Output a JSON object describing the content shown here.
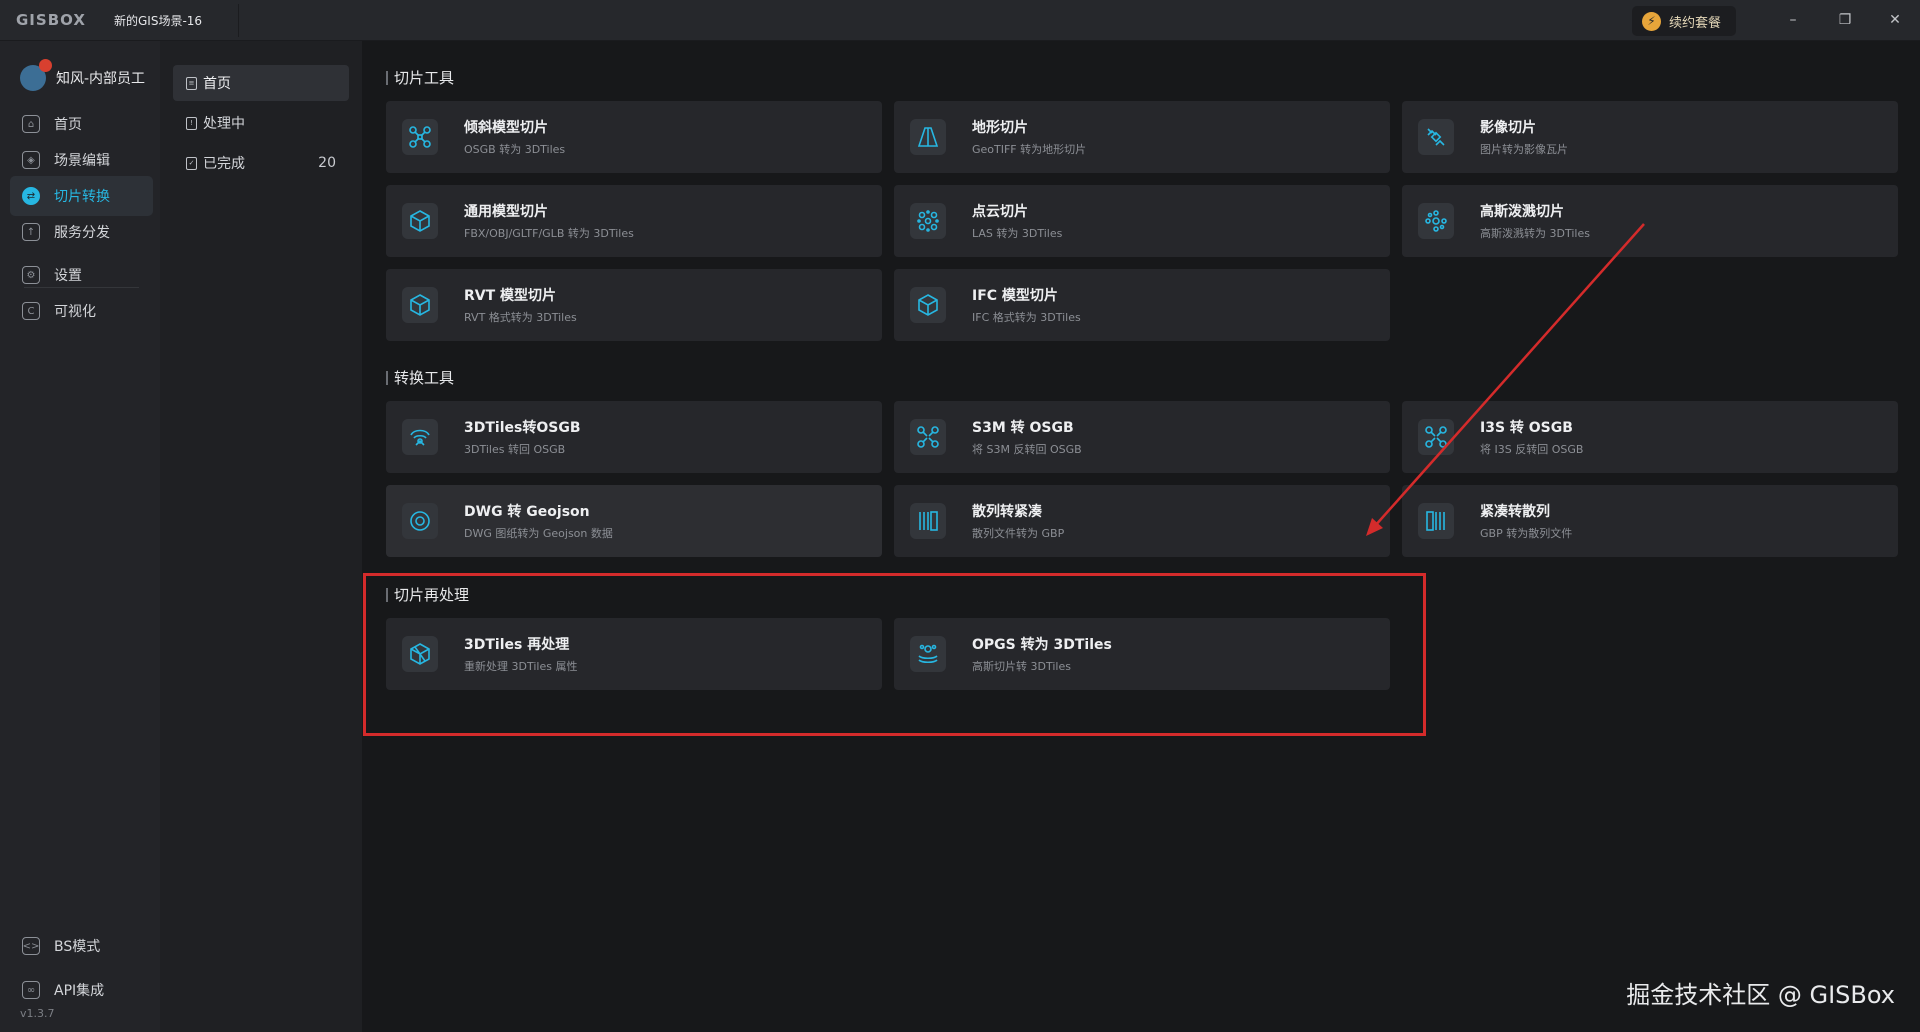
{
  "titlebar": {
    "logo": "GISBOX",
    "tab": "新的GIS场景-16",
    "renew_label": "续约套餐",
    "minimize": "–",
    "maximize": "❐",
    "close": "✕"
  },
  "user": {
    "name": "知风-内部员工"
  },
  "nav": [
    {
      "label": "首页",
      "icon": "home-icon",
      "active": false
    },
    {
      "label": "场景编辑",
      "icon": "cube-icon",
      "active": false
    },
    {
      "label": "切片转换",
      "icon": "swap-icon",
      "active": true
    },
    {
      "label": "服务分发",
      "icon": "upload-icon",
      "active": false
    },
    {
      "label": "设置",
      "icon": "gear-icon",
      "active": false
    },
    {
      "label": "可视化",
      "icon": "visual-icon",
      "active": false
    }
  ],
  "nav_bottom": [
    {
      "label": "BS模式",
      "icon": "code-icon"
    },
    {
      "label": "API集成",
      "icon": "link-icon"
    }
  ],
  "version": "v1.3.7",
  "subnav": [
    {
      "label": "首页",
      "count": ""
    },
    {
      "label": "处理中",
      "count": ""
    },
    {
      "label": "已完成",
      "count": "20"
    }
  ],
  "sections": [
    {
      "title": "切片工具",
      "cards": [
        {
          "title": "倾斜模型切片",
          "sub": "OSGB 转为 3DTiles",
          "icon": "drone-icon"
        },
        {
          "title": "地形切片",
          "sub": "GeoTIFF 转为地形切片",
          "icon": "terrain-icon"
        },
        {
          "title": "影像切片",
          "sub": "图片转为影像瓦片",
          "icon": "satellite-icon"
        },
        {
          "title": "通用模型切片",
          "sub": "FBX/OBJ/GLTF/GLB 转为 3DTiles",
          "icon": "box-icon"
        },
        {
          "title": "点云切片",
          "sub": "LAS 转为 3DTiles",
          "icon": "pointcloud-icon"
        },
        {
          "title": "高斯泼溅切片",
          "sub": "高斯泼溅转为 3DTiles",
          "icon": "gaussian-icon"
        },
        {
          "title": "RVT 模型切片",
          "sub": "RVT 格式转为 3DTiles",
          "icon": "box-icon"
        },
        {
          "title": "IFC 模型切片",
          "sub": "IFC 格式转为 3DTiles",
          "icon": "box-icon"
        }
      ]
    },
    {
      "title": "转换工具",
      "cards": [
        {
          "title": "3DTiles转OSGB",
          "sub": "3DTiles 转回 OSGB",
          "icon": "convert-icon"
        },
        {
          "title": "S3M 转 OSGB",
          "sub": "将 S3M 反转回 OSGB",
          "icon": "drone-icon"
        },
        {
          "title": "I3S 转 OSGB",
          "sub": "将 I3S 反转回 OSGB",
          "icon": "drone-icon"
        },
        {
          "title": "DWG 转 Geojson",
          "sub": "DWG 图纸转为 Geojson 数据",
          "icon": "target-icon"
        },
        {
          "title": "散列转紧凑",
          "sub": "散列文件转为 GBP",
          "icon": "columns-icon"
        },
        {
          "title": "紧凑转散列",
          "sub": "GBP 转为散列文件",
          "icon": "columns-icon"
        }
      ]
    },
    {
      "title": "切片再处理",
      "cards": [
        {
          "title": "3DTiles 再处理",
          "sub": "重新处理 3DTiles 属性",
          "icon": "box-icon"
        },
        {
          "title": "OPGS 转为 3DTiles",
          "sub": "高斯切片转 3DTiles",
          "icon": "gaussian-icon"
        }
      ]
    }
  ],
  "watermark": "掘金技术社区 @ GISBox",
  "colors": {
    "accent": "#27b7e2",
    "annotation": "#d42b2b"
  }
}
